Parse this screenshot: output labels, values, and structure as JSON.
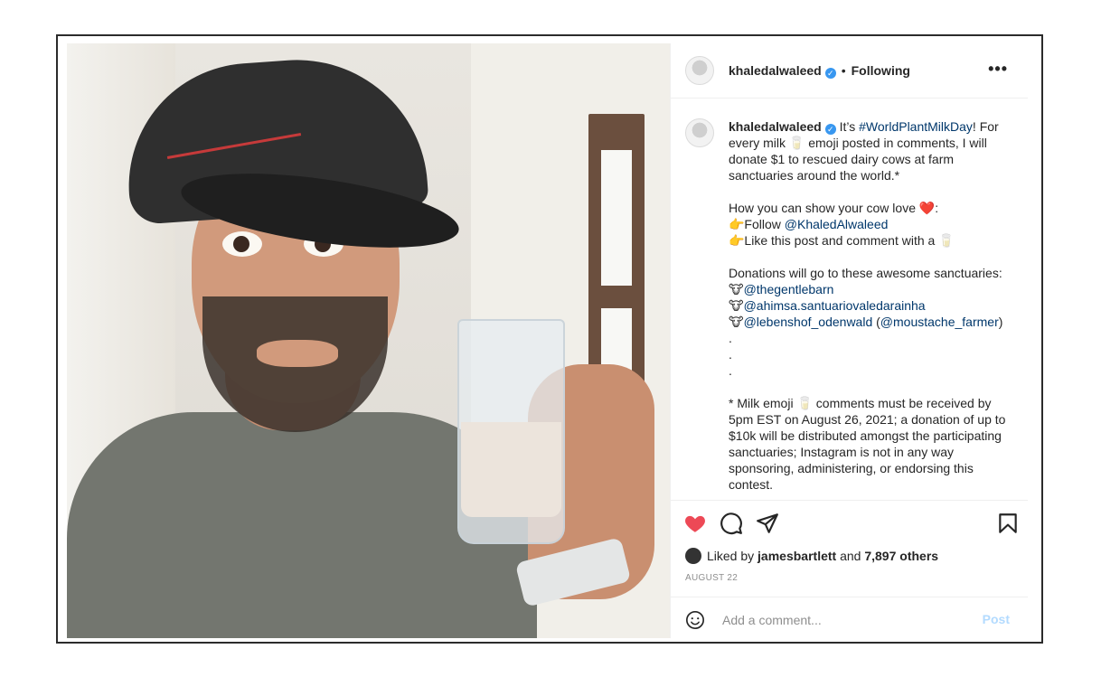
{
  "post": {
    "username": "khaledalwaleed",
    "follow_status": "Following",
    "more_label": "•••",
    "verified_mark": "✓"
  },
  "caption": {
    "username": "khaledalwaleed",
    "lines": [
      "It’s",
      "#WorldPlantMilkDay",
      "! For",
      "every milk 🥛 emoji posted in comments, I will",
      "donate $1 to rescued dairy cows at farm",
      "sanctuaries around the world.*",
      "How you can show your cow love ❤️:",
      "👉Follow ",
      "@KhaledAlwaleed",
      "👉Like this post and comment with a 🥛",
      "Donations will go to these awesome sanctuaries:",
      "🐮",
      "@thegentlebarn",
      "🐮",
      "@ahimsa.santuariovaledarainha",
      "🐮",
      "@lebenshof_odenwald",
      " (",
      "@moustache_farmer",
      ")",
      ".",
      ".",
      ".",
      "* Milk emoji 🥛 comments must be received by",
      "5pm EST on August 26, 2021; a donation of up to",
      "$10k will be distributed amongst the participating",
      "sanctuaries; Instagram is not in any way",
      "sponsoring, administering, or endorsing this",
      "contest."
    ]
  },
  "likes": {
    "prefix": "Liked by ",
    "user": "jamesbartlett",
    "middle": " and ",
    "count": "7,897 others"
  },
  "date": "AUGUST 22",
  "comment": {
    "placeholder": "Add a comment...",
    "post_label": "Post"
  },
  "colors": {
    "heart": "#ed4956",
    "link": "#00376b",
    "verified": "#3897f0",
    "post_disabled": "#b3dbff"
  },
  "icons": [
    "heart-filled-icon",
    "comment-icon",
    "share-icon",
    "bookmark-icon",
    "emoji-icon",
    "verified-icon",
    "more-icon"
  ]
}
